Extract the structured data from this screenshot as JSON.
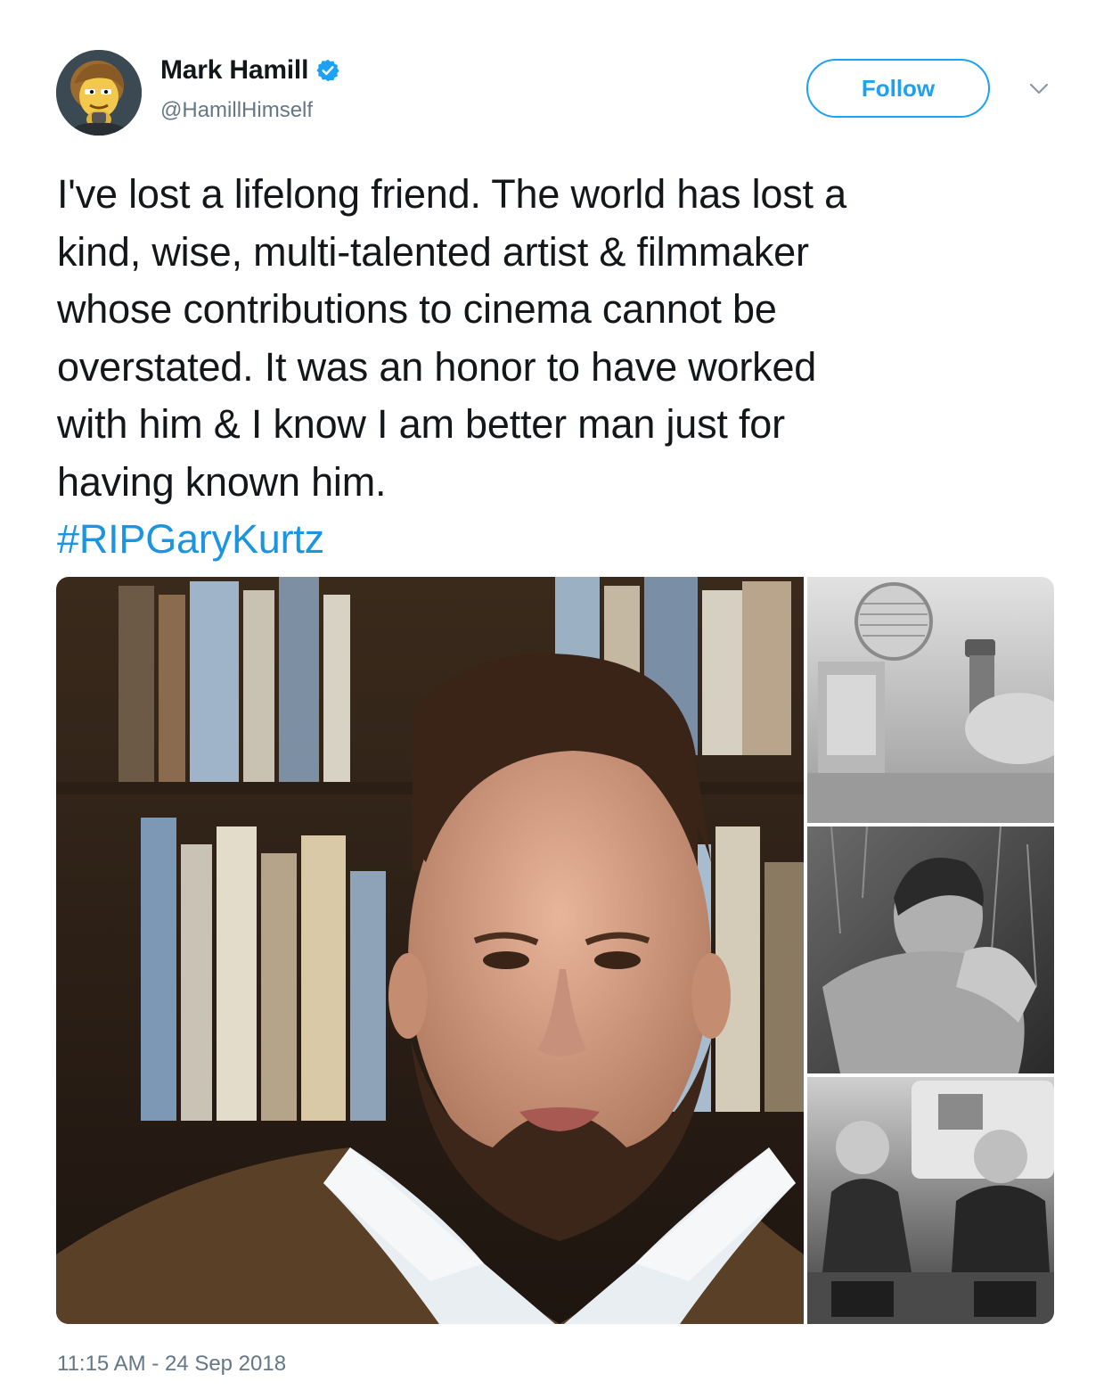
{
  "author": {
    "name": "Mark Hamill",
    "handle": "@HamillHimself",
    "verified": true
  },
  "follow_button": {
    "label": "Follow"
  },
  "tweet": {
    "lines": [
      "I've lost a lifelong friend. The world has lost a",
      "kind, wise, multi-talented artist & filmmaker",
      "whose contributions to cinema cannot be",
      "overstated. It was an honor to have worked",
      "with him & I know I am better man just for",
      "having known him."
    ],
    "hashtag": "#RIPGaryKurtz"
  },
  "timestamp": "11:15 AM - 24 Sep 2018",
  "colors": {
    "accent": "#1da1f2",
    "hashtag": "#1b95e0",
    "muted": "#657786",
    "text": "#14171a"
  },
  "icons": {
    "verified": "verified-badge-icon",
    "more": "chevron-down-icon"
  }
}
